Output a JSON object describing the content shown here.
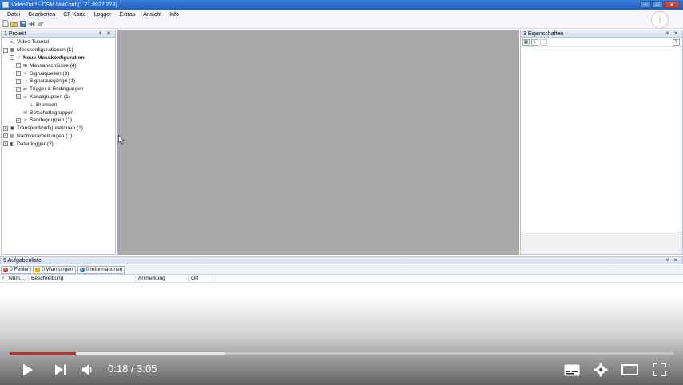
{
  "window": {
    "title": "VideoTut * - CSM UniConf (1.21.8927.278)",
    "minimize": "–",
    "maximize": "□",
    "close": "✕"
  },
  "menu": [
    "Datei",
    "Bearbeiten",
    "CF-Karte",
    "Logger",
    "Extras",
    "Ansicht",
    "Info"
  ],
  "overlay": {
    "info_glyph": "i"
  },
  "project_panel": {
    "title": "1 Projekt",
    "controls": "ᵠ ✕",
    "tree": [
      {
        "label": "Video Tutorial",
        "level": 0,
        "expander": "",
        "icon": "doc-icon",
        "glyph": "▭"
      },
      {
        "label": "Messkonfigurationen (1)",
        "level": 0,
        "expander": "−",
        "icon": "grid-icon",
        "glyph": "▦"
      },
      {
        "label": "Neue Messkonfiguration",
        "level": 1,
        "expander": "−",
        "icon": "config-icon",
        "glyph": "✓",
        "bold": true
      },
      {
        "label": "Messanschlüsse (4)",
        "level": 2,
        "expander": "+",
        "icon": "connector-icon",
        "glyph": "⊞"
      },
      {
        "label": "Signalquellen (3)",
        "level": 2,
        "expander": "+",
        "icon": "signal-source-icon",
        "glyph": "∿"
      },
      {
        "label": "Signalausgänge (1)",
        "level": 2,
        "expander": "+",
        "icon": "signal-output-icon",
        "glyph": "⇥"
      },
      {
        "label": "Trigger & Bedingungen",
        "level": 2,
        "expander": "+",
        "icon": "trigger-icon",
        "glyph": "⇄"
      },
      {
        "label": "Kanalgruppen (1)",
        "level": 2,
        "expander": "−",
        "icon": "folder-icon",
        "glyph": "▱"
      },
      {
        "label": "Bremsen",
        "level": 3,
        "expander": "",
        "icon": "group-icon",
        "glyph": "⊥"
      },
      {
        "label": "Botschaftsgruppen",
        "level": 2,
        "expander": "",
        "icon": "message-icon",
        "glyph": "✉"
      },
      {
        "label": "Sendegruppen (1)",
        "level": 2,
        "expander": "+",
        "icon": "send-icon",
        "glyph": "➚"
      },
      {
        "label": "Transportkonfigurationen (1)",
        "level": 0,
        "expander": "+",
        "icon": "transport-icon",
        "glyph": "▣"
      },
      {
        "label": "Nachverarbeitungen (1)",
        "level": 0,
        "expander": "+",
        "icon": "postprocess-icon",
        "glyph": "▤"
      },
      {
        "label": "Datenlogger (2)",
        "level": 0,
        "expander": "+",
        "icon": "datalogger-icon",
        "glyph": "◧"
      }
    ]
  },
  "properties_panel": {
    "title": "3 Eigenschaften",
    "controls": "ᵠ ✕",
    "help": "?"
  },
  "task_panel": {
    "title": "5 Aufgabenliste",
    "controls": "ᵠ ✕",
    "filters": [
      {
        "label": "0 Fehler",
        "color": "#d0312d",
        "glyph": "✕"
      },
      {
        "label": "0 Warnungen",
        "color": "#e0b400",
        "glyph": "!"
      },
      {
        "label": "0 Informationen",
        "color": "#3b73c2",
        "glyph": "i"
      }
    ],
    "columns": [
      "!",
      "Num...",
      "Beschreibung",
      "Anmerkung",
      "Ort"
    ]
  },
  "video": {
    "current_time": "0:18",
    "duration": "3:05",
    "time_display": "0:18 / 3:05",
    "played_fraction": 0.1
  }
}
